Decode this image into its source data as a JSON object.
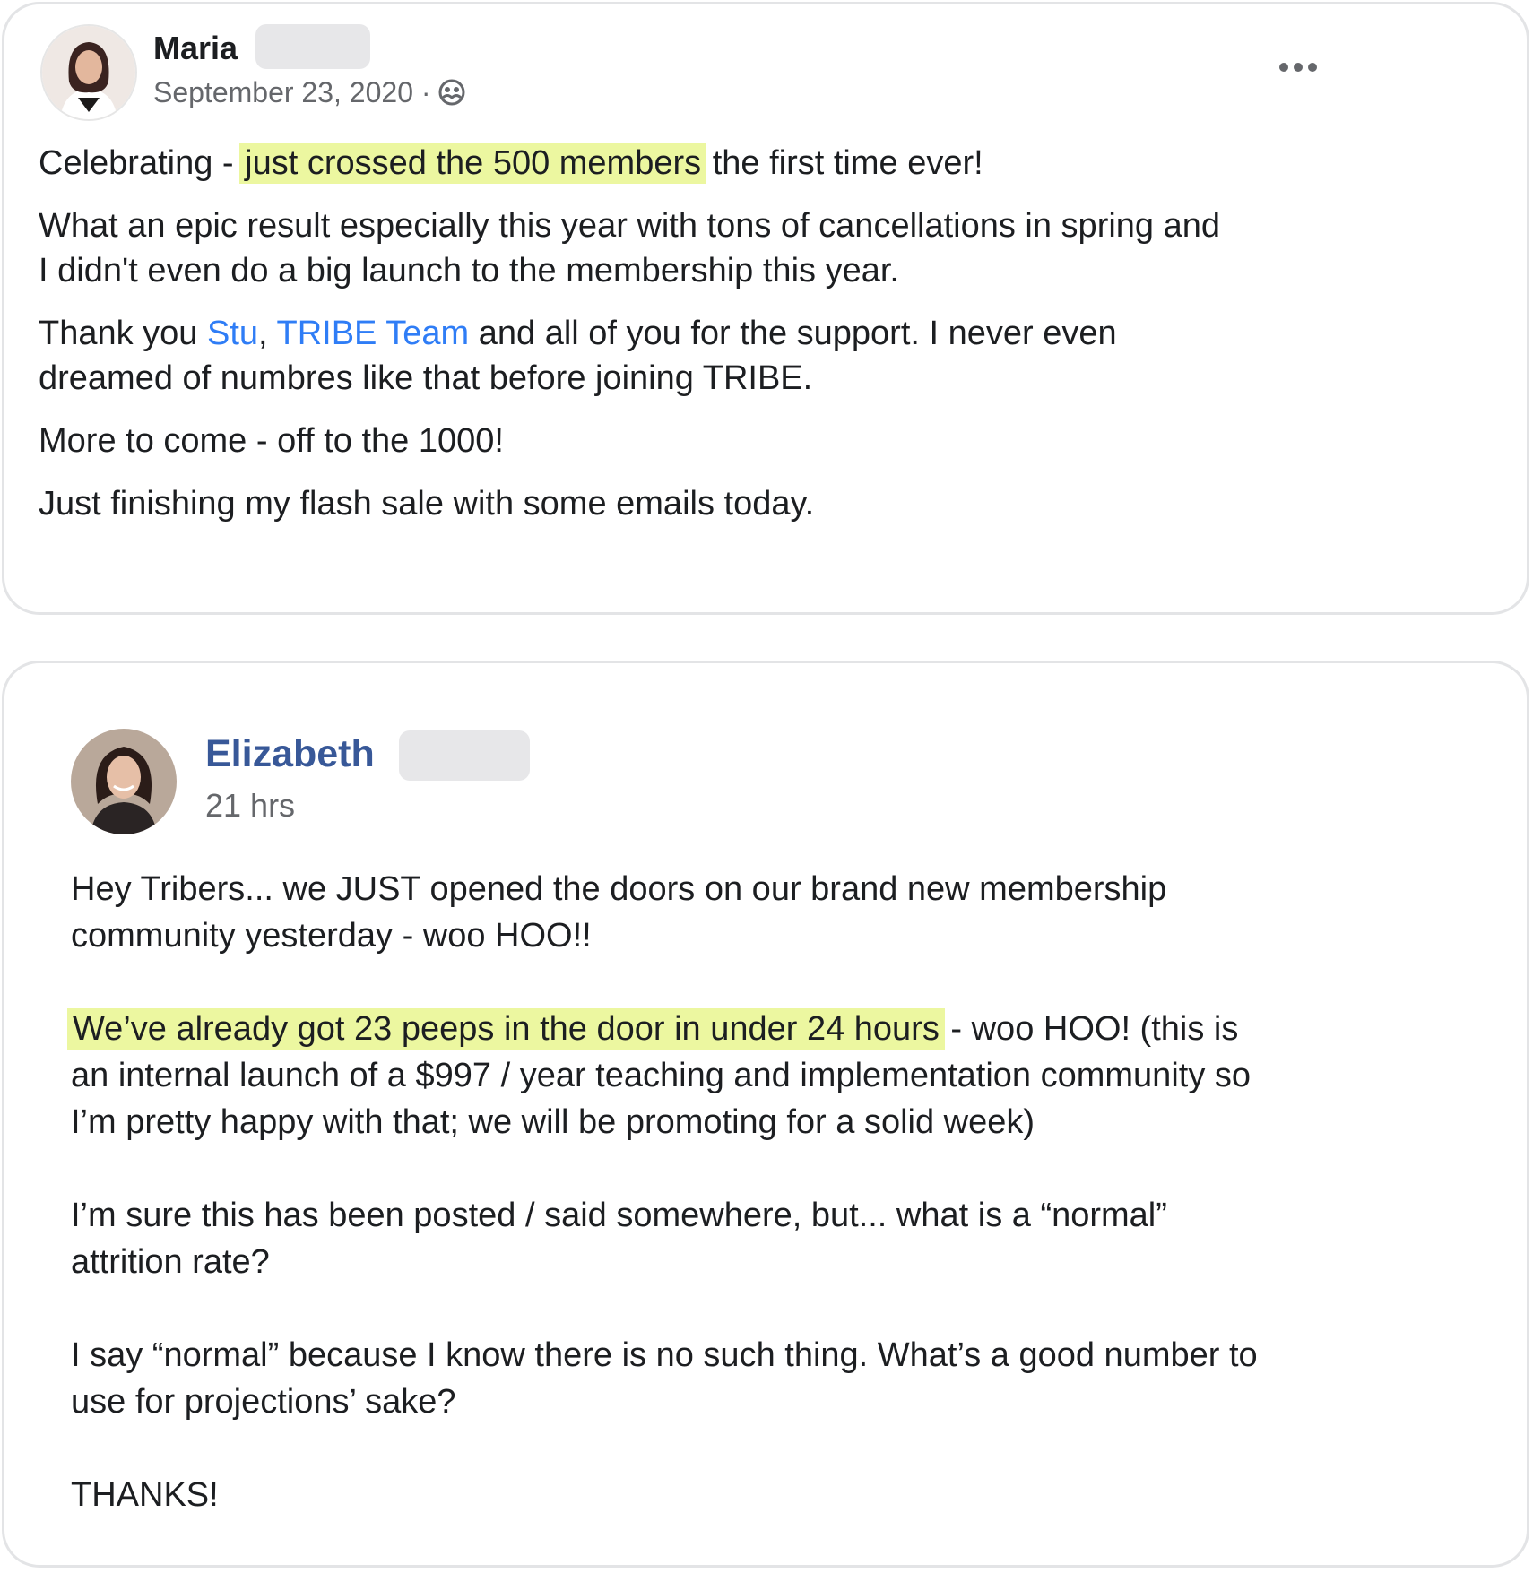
{
  "colors": {
    "highlight": "#ecf7a0",
    "link": "#2f7df6",
    "author_link": "#385898",
    "meta_text": "#65676b",
    "body_text": "#1c1e21",
    "border": "#e3e4e6",
    "redaction": "#e7e7e9"
  },
  "post1": {
    "author": "Maria",
    "date": "September 23, 2020",
    "separator": "·",
    "audience_icon": "group-icon",
    "more_icon": "more-options-icon",
    "p1": {
      "before": "Celebrating - ",
      "highlight": "just crossed the 500 members",
      "after": " the first time ever!"
    },
    "p2": {
      "line1": "What an epic result especially this year with tons of cancellations in spring and",
      "line2": "I didn't even do a big launch to the membership this year."
    },
    "p3": {
      "before": "Thank you ",
      "mention1": "Stu",
      "comma": ", ",
      "mention2": "TRIBE Team",
      "line1_after": " and all of you for the support. I never even",
      "line2": "dreamed of numbres like that before joining TRIBE."
    },
    "p4": "More to come - off to the 1000!",
    "p5": "Just finishing my flash sale with some emails today."
  },
  "post2": {
    "author": "Elizabeth",
    "time": "21 hrs",
    "p1": {
      "line1": "Hey Tribers... we JUST opened the doors on our brand new membership",
      "line2": "community yesterday - woo HOO!!"
    },
    "p2": {
      "highlight": "We’ve already got 23 peeps in the door in under 24 hours",
      "line1_after": " - woo HOO! (this is",
      "line2": "an internal launch of a $997 / year teaching and implementation community so",
      "line3": "I’m pretty happy with that; we will be promoting for a solid week)"
    },
    "p3": {
      "line1": "I’m sure this has been posted / said somewhere, but... what is a “normal”",
      "line2": "attrition rate?"
    },
    "p4": {
      "line1": "I say “normal” because I know there is no such thing. What’s a good number to",
      "line2": "use for projections’ sake?"
    },
    "p5": "THANKS!"
  }
}
